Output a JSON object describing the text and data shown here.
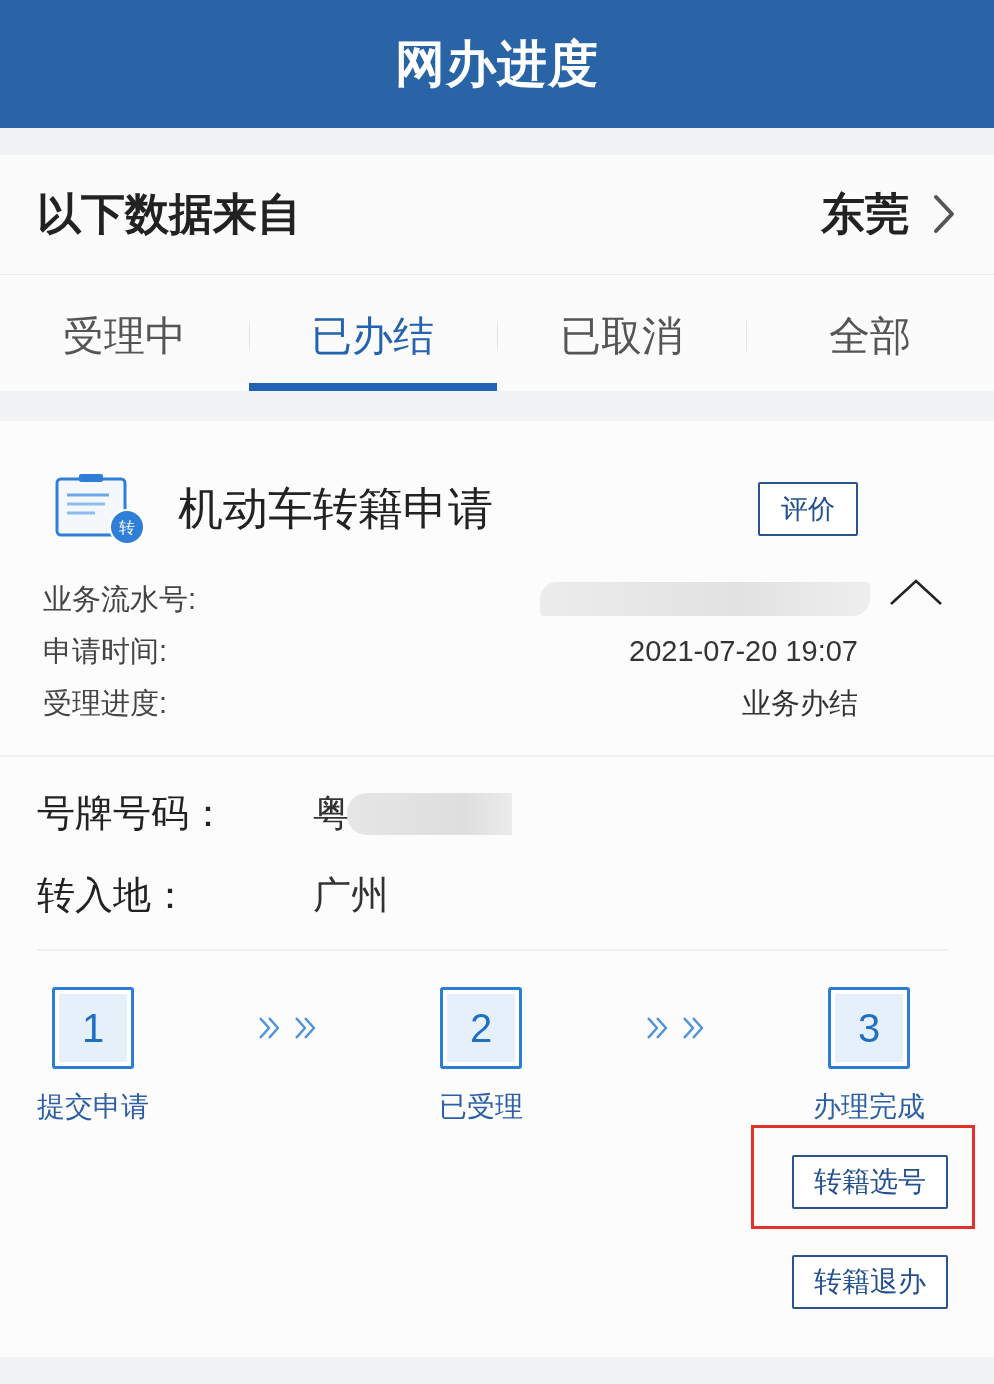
{
  "header": {
    "title": "网办进度"
  },
  "source": {
    "label": "以下数据来自",
    "city": "东莞"
  },
  "tabs": [
    {
      "label": "受理中",
      "selected": false
    },
    {
      "label": "已办结",
      "selected": true
    },
    {
      "label": "已取消",
      "selected": false
    },
    {
      "label": "全部",
      "selected": false
    }
  ],
  "application": {
    "title": "机动车转籍申请",
    "badge": "转",
    "rate_button": "评价",
    "expanded": true,
    "fields": [
      {
        "label": "业务流水号:",
        "redacted": true
      },
      {
        "label": "申请时间:",
        "value": "2021-07-20 19:07",
        "redacted": false
      },
      {
        "label": "受理进度:",
        "value": "业务办结",
        "redacted": false
      }
    ]
  },
  "details": [
    {
      "label": "号牌号码：",
      "value": "粤",
      "redacted": true
    },
    {
      "label": "转入地：",
      "value": "广州",
      "redacted": false
    }
  ],
  "steps": [
    {
      "number": "1",
      "label": "提交申请"
    },
    {
      "number": "2",
      "label": "已受理"
    },
    {
      "number": "3",
      "label": "办理完成"
    }
  ],
  "actions": [
    {
      "label": "转籍选号",
      "highlighted": true
    },
    {
      "label": "转籍退办",
      "highlighted": false
    }
  ]
}
